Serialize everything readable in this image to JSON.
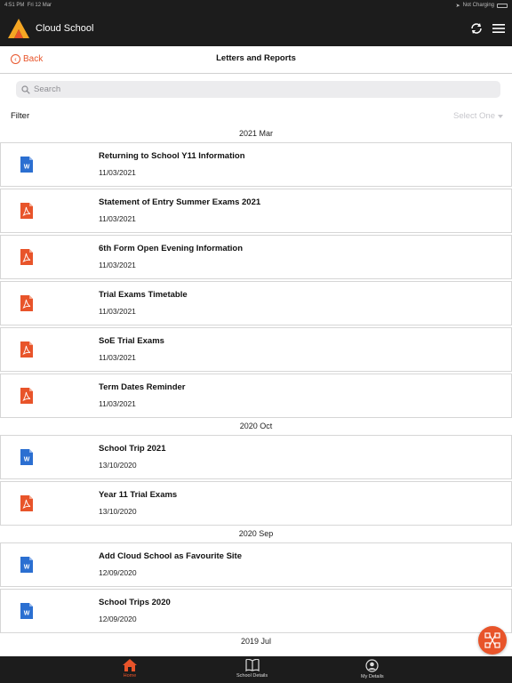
{
  "status_bar": {
    "time": "4:51 PM",
    "date": "Fri 12 Mar",
    "battery": "Not Charging"
  },
  "app": {
    "title": "Cloud School",
    "brand_color": "#e8542a"
  },
  "nav": {
    "back_label": "Back",
    "title": "Letters and Reports"
  },
  "search": {
    "placeholder": "Search"
  },
  "filter": {
    "label": "Filter",
    "select_value": "Select One"
  },
  "sections": [
    {
      "header": "2021 Mar",
      "items": [
        {
          "type": "word",
          "title": "Returning to School Y11 Information",
          "date": "11/03/2021"
        },
        {
          "type": "pdf",
          "title": "Statement of Entry Summer Exams 2021",
          "date": "11/03/2021"
        },
        {
          "type": "pdf",
          "title": "6th Form Open Evening Information",
          "date": "11/03/2021"
        },
        {
          "type": "pdf",
          "title": "Trial Exams Timetable",
          "date": "11/03/2021"
        },
        {
          "type": "pdf",
          "title": "SoE Trial Exams",
          "date": "11/03/2021"
        },
        {
          "type": "pdf",
          "title": "Term Dates Reminder",
          "date": "11/03/2021"
        }
      ]
    },
    {
      "header": "2020 Oct",
      "items": [
        {
          "type": "word",
          "title": "School Trip 2021",
          "date": "13/10/2020"
        },
        {
          "type": "pdf",
          "title": "Year 11 Trial Exams",
          "date": "13/10/2020"
        }
      ]
    },
    {
      "header": "2020 Sep",
      "items": [
        {
          "type": "word",
          "title": "Add Cloud School as Favourite Site",
          "date": "12/09/2020"
        },
        {
          "type": "word",
          "title": "School Trips 2020",
          "date": "12/09/2020"
        }
      ]
    },
    {
      "header": "2019 Jul",
      "items": []
    }
  ],
  "tabs": [
    {
      "label": "Home",
      "icon": "home-icon",
      "active": true
    },
    {
      "label": "School Details",
      "icon": "book-icon",
      "active": false
    },
    {
      "label": "My Details",
      "icon": "user-icon",
      "active": false
    }
  ]
}
